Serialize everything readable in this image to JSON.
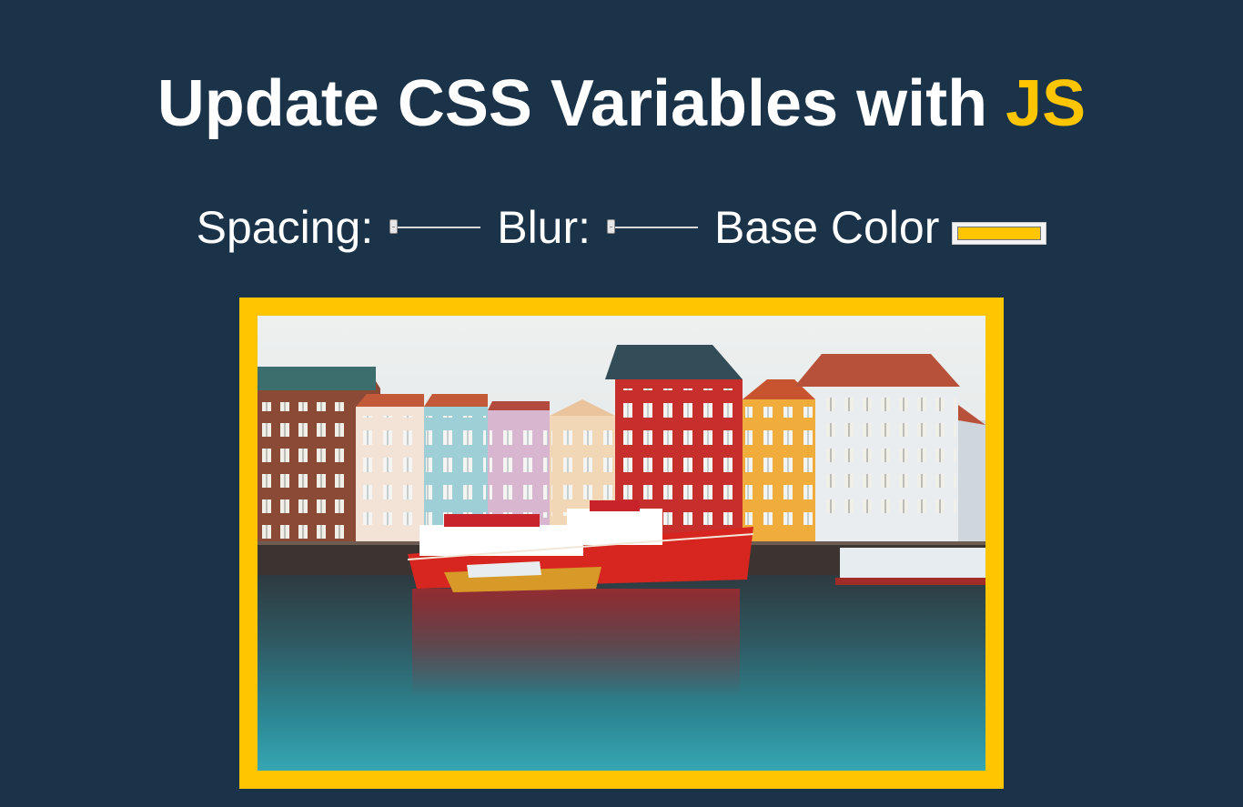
{
  "header": {
    "title_main": "Update CSS Variables with",
    "title_highlight": "JS"
  },
  "controls": {
    "spacing_label": "Spacing:",
    "spacing_value": 10,
    "spacing_range": [
      10,
      200
    ],
    "blur_label": "Blur:",
    "blur_value": 0,
    "blur_range": [
      0,
      25
    ],
    "base_color_label": "Base Color",
    "base_color_value": "#ffc600"
  },
  "image": {
    "description_alt": "",
    "border_color": "#ffc600"
  },
  "colors": {
    "background": "#193549",
    "accent": "#ffc600",
    "text": "#ffffff"
  }
}
